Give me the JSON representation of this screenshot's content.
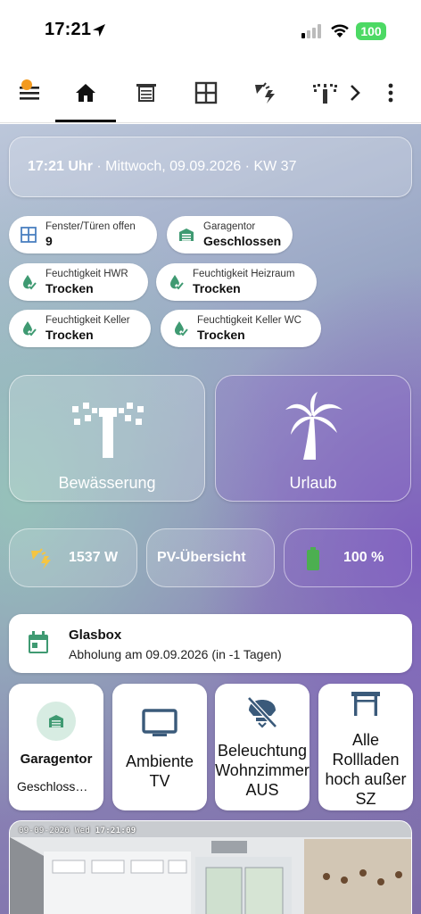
{
  "status_bar": {
    "time": "17:21",
    "battery": "100"
  },
  "nav": {
    "tabs": [
      "home-icon",
      "blinds-icon",
      "window-icon",
      "weather-power-icon",
      "sprinkler-icon"
    ],
    "more": "more-vert-icon",
    "next": "chevron-right-icon"
  },
  "date_card": {
    "time": "17:21 Uhr",
    "rest": " · Mittwoch, 09.09.2026 · KW 37"
  },
  "chips": [
    {
      "label": "Fenster/Türen offen",
      "value": "9"
    },
    {
      "label": "Garagentor",
      "value": "Geschlossen"
    },
    {
      "label": "Feuchtigkeit HWR",
      "value": "Trocken"
    },
    {
      "label": "Feuchtigkeit Heizraum",
      "value": "Trocken"
    },
    {
      "label": "Feuchtigkeit Keller",
      "value": "Trocken"
    },
    {
      "label": "Feuchtigkeit Keller WC",
      "value": "Trocken"
    }
  ],
  "big_tiles": {
    "irrigation": "Bewässerung",
    "vacation": "Urlaub"
  },
  "pills": {
    "pv_power": "1537 W",
    "pv_overview": "PV-Übersicht",
    "battery": "100 %"
  },
  "glasbox": {
    "title": "Glasbox",
    "subtitle": "Abholung am 09.09.2026 (in -1 Tagen)"
  },
  "tiles": {
    "garage_title": "Garagentor",
    "garage_state": "Geschloss…",
    "ambiente_1": "Ambiente",
    "ambiente_2": "TV",
    "light_1": "Beleuchtung",
    "light_2": "Wohnzimmer",
    "light_3": "AUS",
    "roll_1": "Alle",
    "roll_2": "Rollladen",
    "roll_3": "hoch außer",
    "roll_4": "SZ"
  },
  "camera": {
    "date": "09-09-2026 Wed",
    "time": "17:21:09"
  },
  "colors": {
    "accent_orange": "#f39a1e",
    "icon_green": "#3f9a72",
    "battery_green": "#4caf50",
    "icon_slate": "#3a5a7a"
  }
}
